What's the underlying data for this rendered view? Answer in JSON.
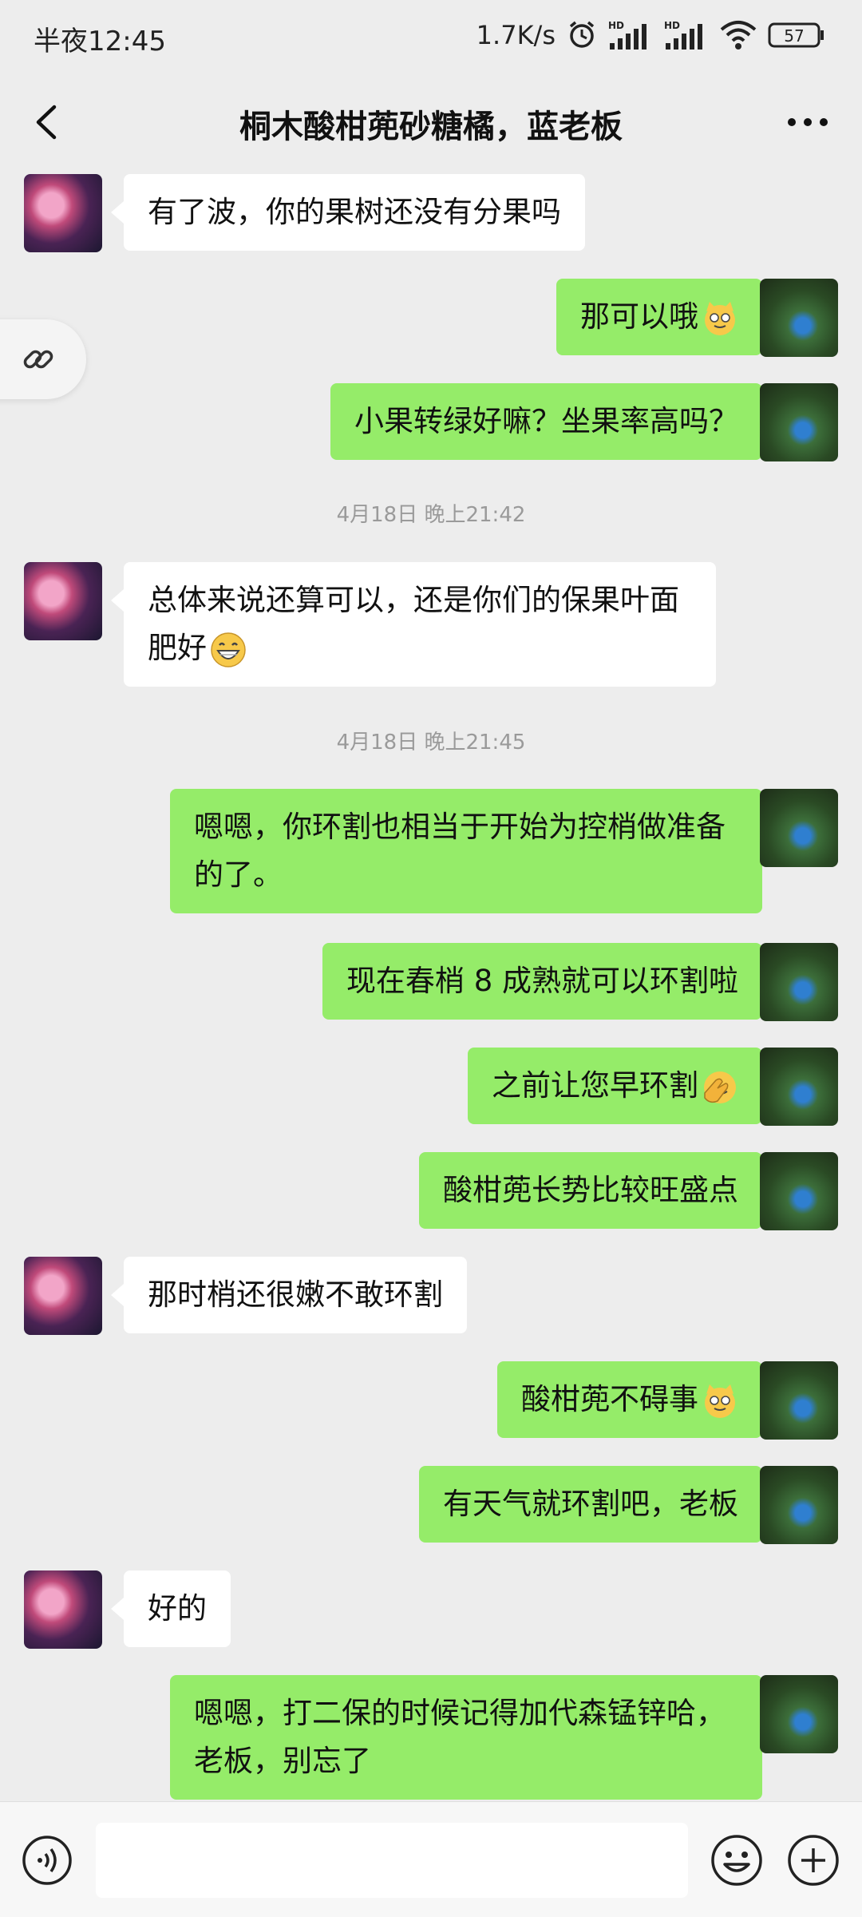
{
  "status_bar": {
    "time": "半夜12:45",
    "network_speed": "1.7K/s",
    "battery": "57"
  },
  "header": {
    "title": "桐木酸柑蔸砂糖橘，蓝老板"
  },
  "chat": {
    "timestamps": [
      "4月18日 晚上21:42",
      "4月18日 晚上21:45"
    ],
    "messages": [
      {
        "side": "in",
        "text": "有了波，你的果树还没有分果吗"
      },
      {
        "side": "out",
        "text": "那可以哦"
      },
      {
        "side": "out",
        "text": "小果转绿好嘛？坐果率高吗？"
      },
      {
        "side": "in",
        "text": "总体来说还算可以，还是你们的保果叶面肥好"
      },
      {
        "side": "out",
        "text": "嗯嗯，你环割也相当于开始为控梢做准备的了。"
      },
      {
        "side": "out",
        "text": "现在春梢 8 成熟就可以环割啦"
      },
      {
        "side": "out",
        "text": "之前让您早环割"
      },
      {
        "side": "out",
        "text": "酸柑蔸长势比较旺盛点"
      },
      {
        "side": "in",
        "text": "那时梢还很嫩不敢环割"
      },
      {
        "side": "out",
        "text": "酸柑蔸不碍事"
      },
      {
        "side": "out",
        "text": "有天气就环割吧，老板"
      },
      {
        "side": "in",
        "text": "好的"
      },
      {
        "side": "out",
        "text": "嗯嗯，打二保的时候记得加代森锰锌哈，老板，别忘了"
      }
    ]
  },
  "input": {
    "placeholder": ""
  },
  "colors": {
    "background": "#ededed",
    "bubble_out": "#95ec69",
    "bubble_in": "#ffffff"
  },
  "icons": [
    "back-arrow-icon",
    "more-icon",
    "link-icon",
    "voice-icon",
    "emoji-icon",
    "plus-icon",
    "cat-emoji-icon",
    "grin-emoji-icon",
    "facepalm-emoji-icon"
  ]
}
